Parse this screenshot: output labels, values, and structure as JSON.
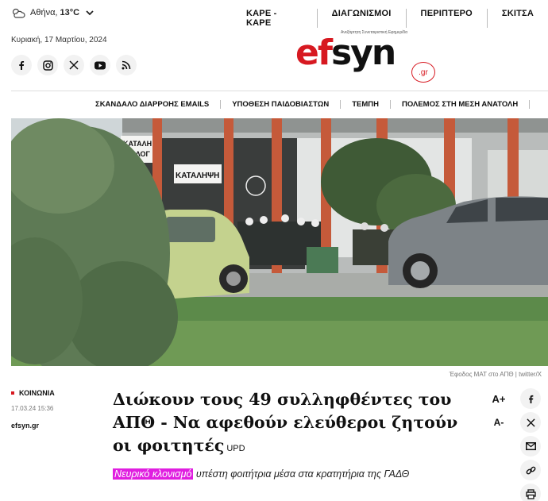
{
  "weather": {
    "city": "Αθήνα,",
    "temperature": "13°C"
  },
  "top_nav": [
    "ΚΑΡΕ - ΚΑΡΕ",
    "ΔΙΑΓΩΝΙΣΜΟΙ",
    "ΠΕΡΙΠΤΕΡΟ",
    "ΣΚΙΤΣΑ"
  ],
  "date": "Κυριακή, 17 Μαρτίου, 2024",
  "socials": [
    "facebook-icon",
    "instagram-icon",
    "x-icon",
    "youtube-icon",
    "rss-icon"
  ],
  "logo": {
    "tagline": "Ανεξάρτητη Συνεταιριστική Εφημερίδα",
    "ef": "ef",
    "syn": "syn",
    "domain": ".gr"
  },
  "section_nav": [
    "ΣΚΑΝΔΑΛΟ ΔΙΑΡΡΟΗΣ EMAILS",
    "ΥΠΟΘΕΣΗ ΠΑΙΔΟΒΙΑΣΤΩΝ",
    "ΤΕΜΠΗ",
    "ΠΟΛΕΜΟΣ ΣΤΗ ΜΕΣΗ ΑΝΑΤΟΛΗ"
  ],
  "hero": {
    "sign_1": "ΚΑΤΑΛΗ",
    "sign_2": "ΒΙΟΛΟΓ",
    "sign_3": "ΚΑΤΑΛΗΨΗ",
    "caption": "Έφοδος ΜΑΤ στο ΑΠΘ | twitter/X"
  },
  "article": {
    "category": "ΚΟΙΝΩΝΙΑ",
    "timestamp": "17.03.24 15:36",
    "source": "efsyn.gr",
    "headline": "Διώκουν τους 49 συλληφθέντες του ΑΠΘ - Να αφεθούν ελεύθεροι ζητούν οι φοιτητές",
    "update_tag": "UPD",
    "lead_highlight": "Νευρικό κλονισμό",
    "lead_rest": " υπέστη φοιτήτρια μέσα στα κρατητήρια της ΓΑΔΘ"
  },
  "tools": {
    "font_increase": "A+",
    "font_decrease": "A-"
  },
  "share": [
    "facebook-icon",
    "x-icon",
    "email-icon",
    "link-icon",
    "print-icon"
  ],
  "colors": {
    "brand_red": "#d71921",
    "highlight_magenta": "#e01ee0"
  }
}
